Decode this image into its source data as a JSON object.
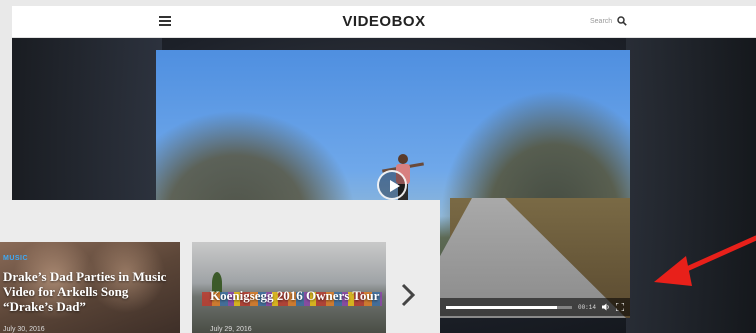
{
  "header": {
    "logo": "VIDEOBOX",
    "menu_icon": "hamburger-menu-icon",
    "search_label": "Search",
    "search_icon": "search-icon"
  },
  "player": {
    "play_icon": "play-icon",
    "time": "00:14",
    "progress": 0.88,
    "volume_icon": "volume-icon",
    "fullscreen_icon": "fullscreen-icon"
  },
  "cards": [
    {
      "category": "MUSIC",
      "title": "Drake’s Dad Parties in Music Video for Arkells Song “Drake’s Dad”",
      "date": "July 30, 2016"
    },
    {
      "category": "",
      "title": "Koenigsegg 2016 Owners Tour",
      "date": "July 29, 2016"
    }
  ],
  "carousel": {
    "next_icon": "chevron-right-icon"
  },
  "annotation": {
    "arrow_icon": "red-arrow-icon",
    "arrow_color": "#e8201a"
  }
}
